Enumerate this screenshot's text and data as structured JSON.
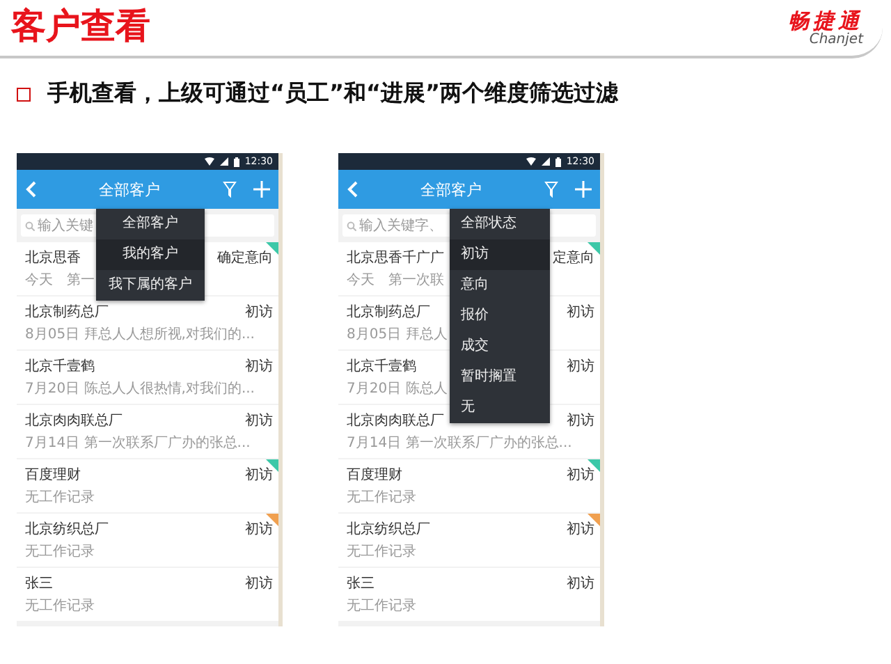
{
  "slide": {
    "title": "客户查看",
    "logo": {
      "name": "畅捷通",
      "latin": "Chanjet"
    },
    "bullet": "手机查看，上级可通过“员工”和“进展”两个维度筛选过滤"
  },
  "phones": [
    {
      "time": "12:30",
      "title": "全部客户",
      "search": {
        "placeholder": "输入关键"
      },
      "menu": {
        "items": [
          {
            "label": "全部客户",
            "selected": false
          },
          {
            "label": "我的客户",
            "selected": true
          },
          {
            "label": "我下属的客户",
            "selected": false
          }
        ]
      },
      "rows": [
        {
          "name": "北京思香",
          "status": "确定意向",
          "note": "今天　第一",
          "color": "#3cc8a8"
        },
        {
          "name": "北京制药总厂",
          "status": "初访",
          "note": "8月05日 拜总人人想所视,对我们的..."
        },
        {
          "name": "北京千壹鹤",
          "status": "初访",
          "note": "7月20日 陈总人人很热情,对我们的..."
        },
        {
          "name": "北京肉肉联总厂",
          "status": "初访",
          "note": "7月14日 第一次联系厂广办的张总..."
        },
        {
          "name": "百度理财",
          "status": "初访",
          "note": "无工作记录",
          "color": "#3cc8a8"
        },
        {
          "name": "北京纺织总厂",
          "status": "初访",
          "note": "无工作记录",
          "color": "#f0a050"
        },
        {
          "name": "张三",
          "status": "初访",
          "note": "无工作记录"
        }
      ]
    },
    {
      "time": "12:30",
      "title": "全部客户",
      "search": {
        "placeholder": "输入关键字、"
      },
      "menu": {
        "items": [
          {
            "label": "全部状态",
            "selected": false
          },
          {
            "label": "初访",
            "selected": true
          },
          {
            "label": "意向",
            "selected": false
          },
          {
            "label": "报价",
            "selected": false
          },
          {
            "label": "成交",
            "selected": false
          },
          {
            "label": "暂时搁置",
            "selected": false
          },
          {
            "label": "无",
            "selected": false
          }
        ]
      },
      "rows": [
        {
          "name": "北京思香千广广",
          "status": "定意向",
          "note": "今天　第一次联",
          "color": "#3cc8a8"
        },
        {
          "name": "北京制药总厂",
          "status": "初访",
          "note": "8月05日 拜总人"
        },
        {
          "name": "北京千壹鹤",
          "status": "初访",
          "note": "7月20日 陈总人"
        },
        {
          "name": "北京肉肉联总厂",
          "status": "初访",
          "note": "7月14日 第一次联系厂广办的张总..."
        },
        {
          "name": "百度理财",
          "status": "初访",
          "note": "无工作记录",
          "color": "#3cc8a8"
        },
        {
          "name": "北京纺织总厂",
          "status": "初访",
          "note": "无工作记录",
          "color": "#f0a050"
        },
        {
          "name": "张三",
          "status": "初访",
          "note": "无工作记录"
        }
      ]
    }
  ]
}
